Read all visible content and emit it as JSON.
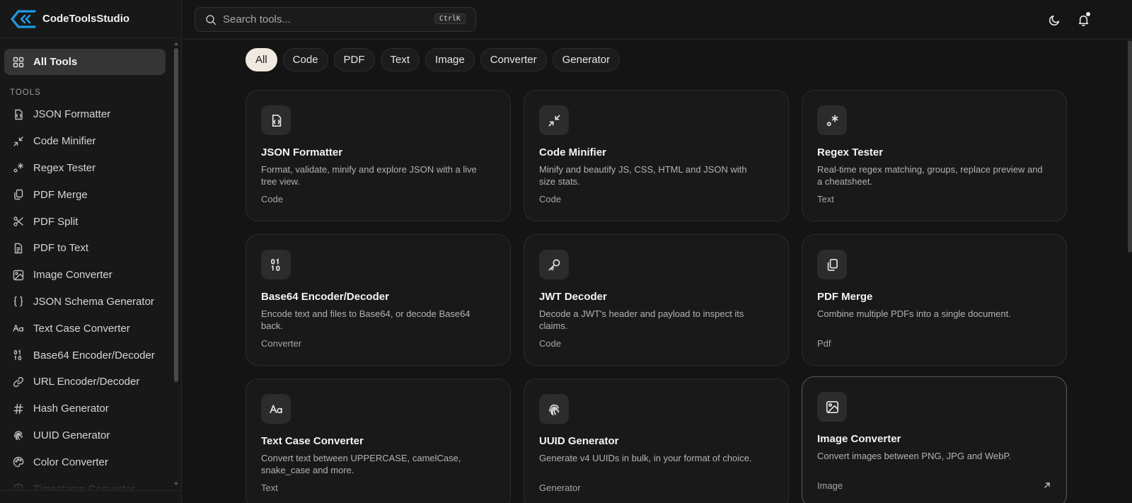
{
  "app": {
    "name": "CodeToolsStudio",
    "accent": "#1e9be6"
  },
  "sidebar": {
    "all_tools_label": "All Tools",
    "section_label": "TOOLS",
    "items": [
      {
        "label": "JSON Formatter",
        "icon": "file-json-icon"
      },
      {
        "label": "Code Minifier",
        "icon": "minimize-icon"
      },
      {
        "label": "Regex Tester",
        "icon": "regex-icon"
      },
      {
        "label": "PDF Merge",
        "icon": "files-icon"
      },
      {
        "label": "PDF Split",
        "icon": "scissors-icon"
      },
      {
        "label": "PDF to Text",
        "icon": "file-text-icon"
      },
      {
        "label": "Image Converter",
        "icon": "image-icon"
      },
      {
        "label": "JSON Schema Generator",
        "icon": "braces-icon"
      },
      {
        "label": "Text Case Converter",
        "icon": "case-icon"
      },
      {
        "label": "Base64 Encoder/Decoder",
        "icon": "binary-icon"
      },
      {
        "label": "URL Encoder/Decoder",
        "icon": "link-icon"
      },
      {
        "label": "Hash Generator",
        "icon": "hash-icon"
      },
      {
        "label": "UUID Generator",
        "icon": "fingerprint-icon"
      },
      {
        "label": "Color Converter",
        "icon": "palette-icon"
      },
      {
        "label": "Timestamp Converter",
        "icon": "clock-icon"
      }
    ]
  },
  "header": {
    "search_placeholder": "Search tools...",
    "shortcut": "CtrlK"
  },
  "filters": [
    {
      "label": "All",
      "active": true
    },
    {
      "label": "Code",
      "active": false
    },
    {
      "label": "PDF",
      "active": false
    },
    {
      "label": "Text",
      "active": false
    },
    {
      "label": "Image",
      "active": false
    },
    {
      "label": "Converter",
      "active": false
    },
    {
      "label": "Generator",
      "active": false
    }
  ],
  "cards": [
    {
      "title": "JSON Formatter",
      "desc": "Format, validate, minify and explore JSON with a live tree view.",
      "category": "Code",
      "icon": "file-json-icon"
    },
    {
      "title": "Code Minifier",
      "desc": "Minify and beautify JS, CSS, HTML and JSON with size stats.",
      "category": "Code",
      "icon": "minimize-icon"
    },
    {
      "title": "Regex Tester",
      "desc": "Real-time regex matching, groups, replace preview and a cheatsheet.",
      "category": "Text",
      "icon": "regex-icon"
    },
    {
      "title": "Base64 Encoder/Decoder",
      "desc": "Encode text and files to Base64, or decode Base64 back.",
      "category": "Converter",
      "icon": "binary-icon"
    },
    {
      "title": "JWT Decoder",
      "desc": "Decode a JWT's header and payload to inspect its claims.",
      "category": "Code",
      "icon": "key-icon"
    },
    {
      "title": "PDF Merge",
      "desc": "Combine multiple PDFs into a single document.",
      "category": "Pdf",
      "icon": "files-icon"
    },
    {
      "title": "Text Case Converter",
      "desc": "Convert text between UPPERCASE, camelCase, snake_case and more.",
      "category": "Text",
      "icon": "case-icon"
    },
    {
      "title": "UUID Generator",
      "desc": "Generate v4 UUIDs in bulk, in your format of choice.",
      "category": "Generator",
      "icon": "fingerprint-icon"
    },
    {
      "title": "Image Converter",
      "desc": "Convert images between PNG, JPG and WebP.",
      "category": "Image",
      "icon": "image-icon",
      "hovered": true
    }
  ]
}
